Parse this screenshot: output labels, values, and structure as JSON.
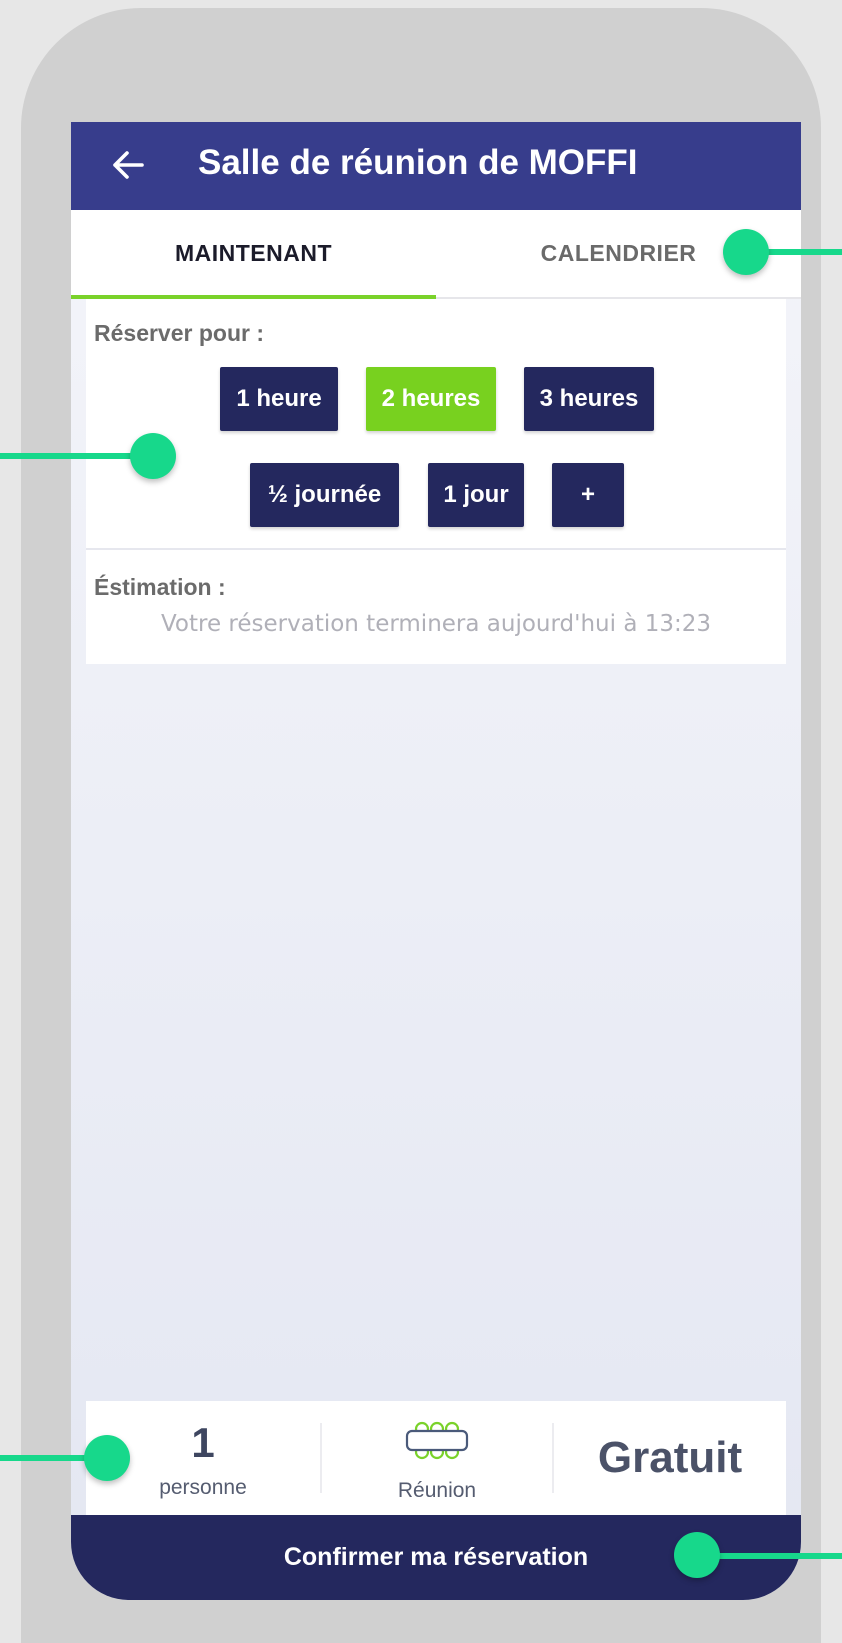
{
  "header": {
    "title": "Salle de réunion de MOFFI",
    "back_icon": "arrow-left-icon"
  },
  "tabs": [
    {
      "label": "MAINTENANT",
      "active": true
    },
    {
      "label": "CALENDRIER",
      "active": false
    }
  ],
  "booking": {
    "label": "Réserver pour :",
    "durations": [
      {
        "label": "1 heure",
        "selected": false
      },
      {
        "label": "2 heures",
        "selected": true
      },
      {
        "label": "3 heures",
        "selected": false
      },
      {
        "label": "½ journée",
        "selected": false
      },
      {
        "label": "1 jour",
        "selected": false
      },
      {
        "label": "+",
        "selected": false
      }
    ]
  },
  "estimate": {
    "label": "Éstimation :",
    "text": "Votre réservation terminera aujourd'hui à 13:23"
  },
  "summary": {
    "count": "1",
    "count_label": "personne",
    "type_label": "Réunion",
    "type_icon": "meeting-table-icon",
    "price": "Gratuit"
  },
  "confirm_label": "Confirmer ma réservation",
  "colors": {
    "header_bg": "#373d8c",
    "button_bg": "#24285e",
    "accent_green": "#78d11f",
    "hotspot": "#17d88b"
  }
}
